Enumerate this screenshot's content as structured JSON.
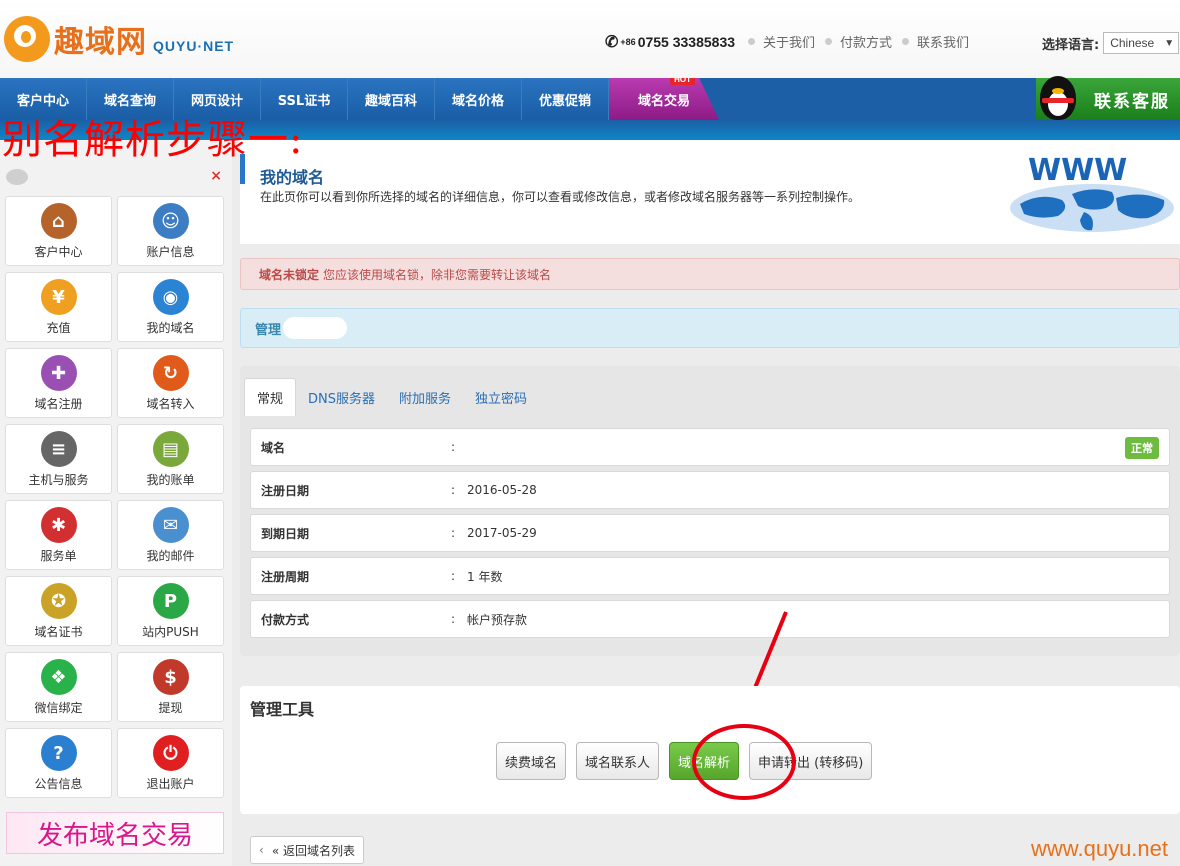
{
  "header": {
    "logo_cn": "趣域网",
    "logo_en": "QUYU·NET",
    "phone_prefix": "+86",
    "phone": "0755 33385833",
    "links": [
      "关于我们",
      "付款方式",
      "联系我们"
    ],
    "lang_label": "选择语言:",
    "lang_value": "Chinese"
  },
  "nav": {
    "items": [
      "客户中心",
      "域名查询",
      "网页设计",
      "SSL证书",
      "趣域百科",
      "域名价格",
      "优惠促销",
      "域名交易"
    ],
    "hot_label": "HOT",
    "kefu_label": "联系客服"
  },
  "annotation": "别名解析步骤一:",
  "sidebar": {
    "tiles": [
      {
        "label": "客户中心",
        "icon": "home-icon",
        "color": "#b5622b",
        "glyph": "⌂"
      },
      {
        "label": "账户信息",
        "icon": "user-icon",
        "color": "#3d7dc4",
        "glyph": "☺"
      },
      {
        "label": "充值",
        "icon": "coins-icon",
        "color": "#f0a020",
        "glyph": "¥"
      },
      {
        "label": "我的域名",
        "icon": "globe-icon",
        "color": "#2a83d3",
        "glyph": "◉"
      },
      {
        "label": "域名注册",
        "icon": "cart-icon",
        "color": "#9a4fb3",
        "glyph": "✚"
      },
      {
        "label": "域名转入",
        "icon": "transfer-icon",
        "color": "#e05a1a",
        "glyph": "↻"
      },
      {
        "label": "主机与服务",
        "icon": "server-icon",
        "color": "#666666",
        "glyph": "≡"
      },
      {
        "label": "我的账单",
        "icon": "bill-icon",
        "color": "#7aa83a",
        "glyph": "▤"
      },
      {
        "label": "服务单",
        "icon": "service-icon",
        "color": "#d23030",
        "glyph": "✱"
      },
      {
        "label": "我的邮件",
        "icon": "mail-icon",
        "color": "#4a8fd0",
        "glyph": "✉"
      },
      {
        "label": "域名证书",
        "icon": "certificate-icon",
        "color": "#c9a227",
        "glyph": "✪"
      },
      {
        "label": "站内PUSH",
        "icon": "push-icon",
        "color": "#2aa845",
        "glyph": "P"
      },
      {
        "label": "微信绑定",
        "icon": "wechat-icon",
        "color": "#2ab24a",
        "glyph": "❖"
      },
      {
        "label": "提现",
        "icon": "withdraw-icon",
        "color": "#c0392b",
        "glyph": "$"
      },
      {
        "label": "公告信息",
        "icon": "help-icon",
        "color": "#2a7fd0",
        "glyph": "?"
      },
      {
        "label": "退出账户",
        "icon": "power-icon",
        "color": "#e02020",
        "glyph": "⏻"
      }
    ],
    "promo": "发布域名交易",
    "close": "×"
  },
  "main": {
    "title": "我的域名",
    "desc": "在此页你可以看到你所选择的域名的详细信息，你可以查看或修改信息，或者修改域名服务器等一系列控制操作。",
    "alert_strong": "域名未锁定",
    "alert_text": "您应该使用域名锁，除非您需要转让该域名",
    "manage_label": "管理",
    "tabs": [
      "常规",
      "DNS服务器",
      "附加服务",
      "独立密码"
    ],
    "rows": [
      {
        "k": "域名",
        "v": ""
      },
      {
        "k": "注册日期",
        "v": "2016-05-28"
      },
      {
        "k": "到期日期",
        "v": "2017-05-29"
      },
      {
        "k": "注册周期",
        "v": "1 年数"
      },
      {
        "k": "付款方式",
        "v": "帐户预存款"
      }
    ],
    "colon": ":",
    "status_badge": "正常",
    "tools_title": "管理工具",
    "buttons": [
      "续费域名",
      "域名联系人",
      "域名解析",
      "申请转出 (转移码)"
    ],
    "back_label": "« 返回域名列表"
  },
  "watermark": "www.quyu.net",
  "www_text": "WWW"
}
